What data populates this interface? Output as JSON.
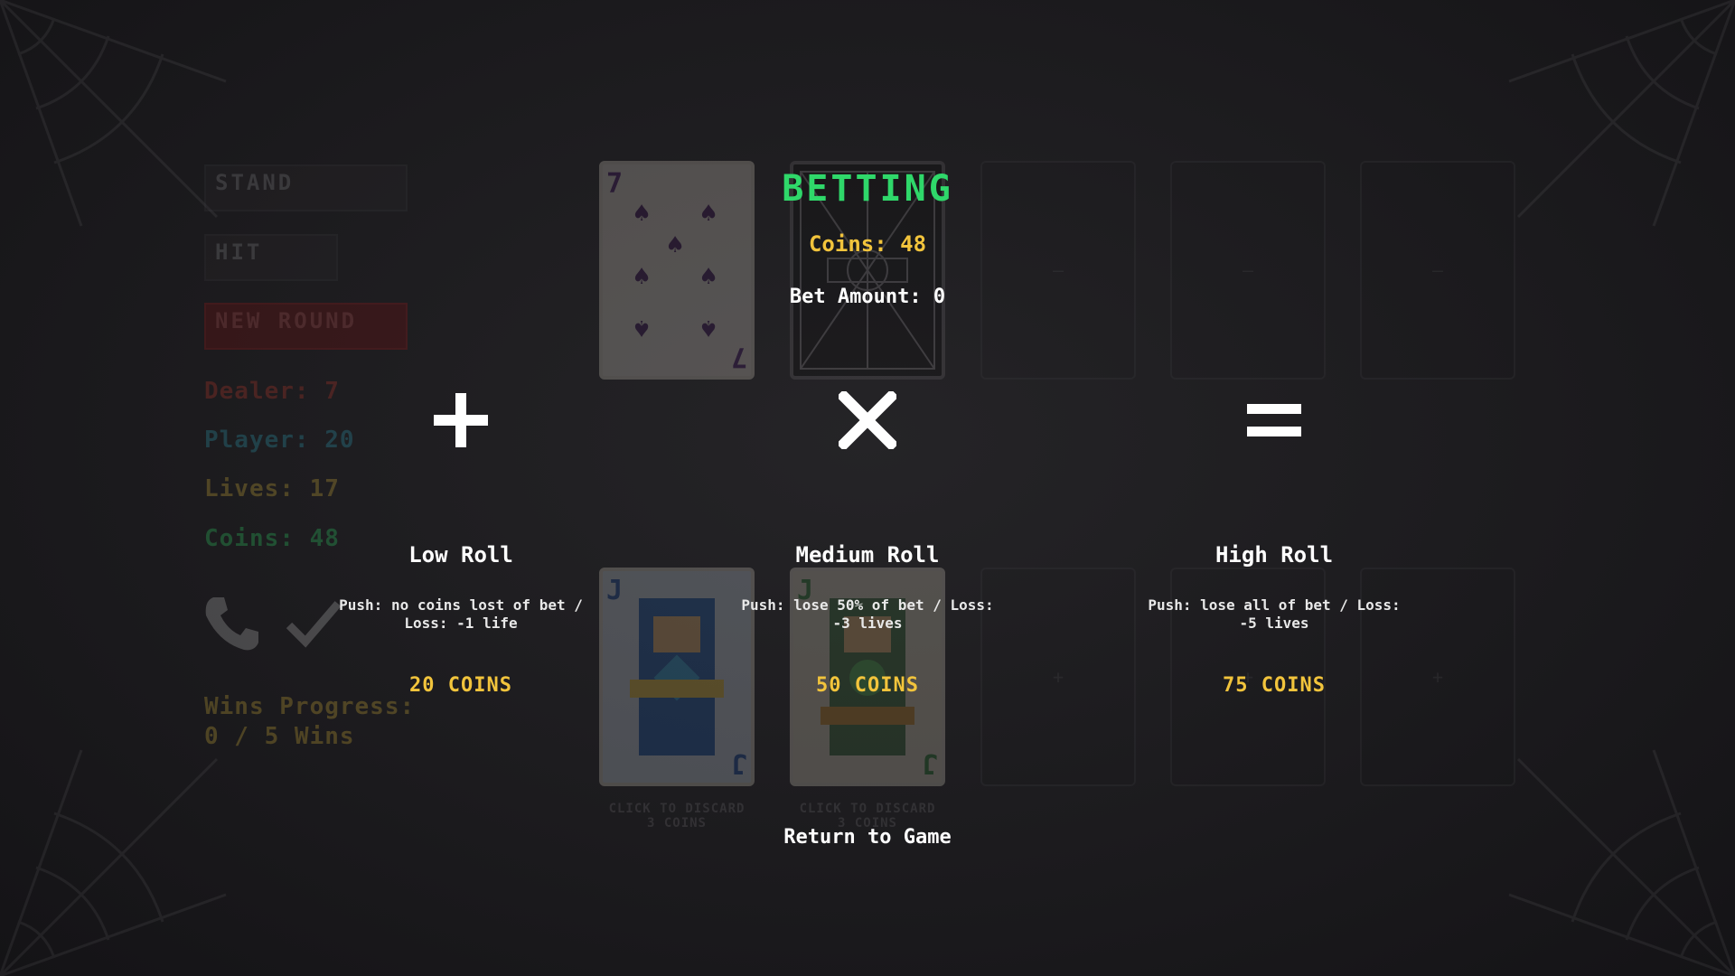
{
  "overlay": {
    "title": "BETTING",
    "coins_label": "Coins: 48",
    "bet_label": "Bet Amount: 0",
    "return_label": "Return to Game"
  },
  "rolls": [
    {
      "name": "Low Roll",
      "desc_line1": "Push: no coins lost of bet /",
      "desc_line2": "Loss: -1 life",
      "price": "20 COINS",
      "icon": "plus-icon"
    },
    {
      "name": "Medium Roll",
      "desc_line1": "Push: lose 50% of bet / Loss:",
      "desc_line2": "-3 lives",
      "price": "50 COINS",
      "icon": "multiply-icon"
    },
    {
      "name": "High Roll",
      "desc_line1": "Push: lose all of bet / Loss:",
      "desc_line2": "-5 lives",
      "price": "75 COINS",
      "icon": "equals-icon"
    }
  ],
  "game": {
    "buttons": {
      "stand": "STAND",
      "hit": "HIT",
      "new_round": "NEW ROUND"
    },
    "stats": {
      "dealer": "Dealer: 7",
      "player": "Player: 20",
      "lives": "Lives: 17",
      "coins": "Coins: 48"
    },
    "wins_progress_line1": "Wins Progress:",
    "wins_progress_line2": "0 / 5 Wins",
    "dealer_card_rank": "7",
    "dealer_card_suit": "♠",
    "player_card_rank": "J",
    "discard_label": "CLICK TO DISCARD",
    "discard_cost": "3 COINS"
  },
  "colors": {
    "title_green": "#2fd86a",
    "gold": "#f2c43c",
    "new_round_red": "#7a1010"
  }
}
